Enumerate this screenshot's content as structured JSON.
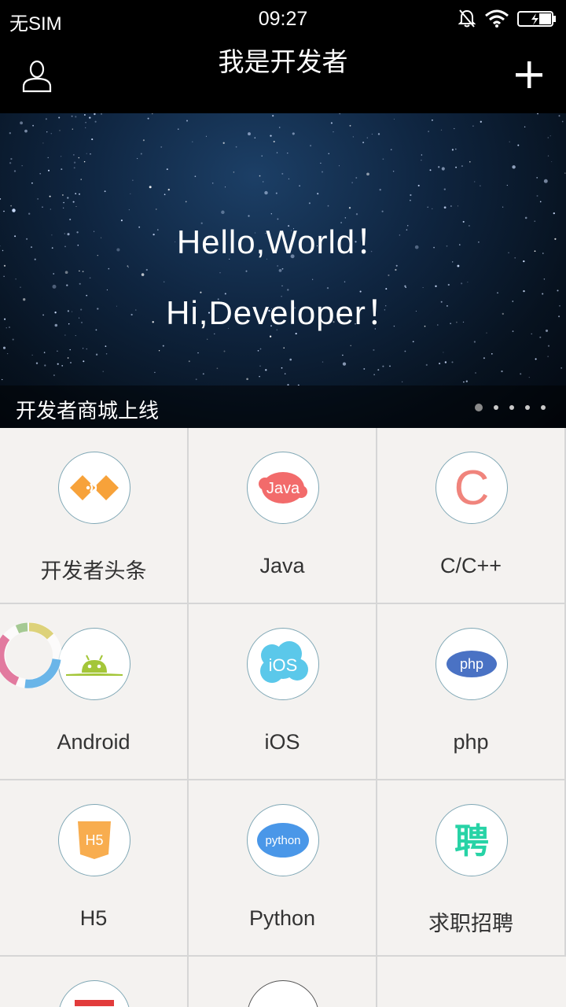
{
  "status_bar": {
    "carrier": "无SIM",
    "time": "09:27",
    "icons": [
      "mute-bell-icon",
      "wifi-icon",
      "battery-charging-icon"
    ]
  },
  "title_bar": {
    "title": "我是开发者",
    "left_icon": "user-icon",
    "right_icon": "plus-icon"
  },
  "banner": {
    "line1": "Hello,World！",
    "line2": "Hi,Developer！",
    "caption": "开发者商城上线",
    "page_count": 5,
    "active_page": 1
  },
  "categories": [
    {
      "label": "开发者头条",
      "icon": "toutiao-icon",
      "icon_text": ""
    },
    {
      "label": "Java",
      "icon": "java-icon",
      "icon_text": "Java"
    },
    {
      "label": "C/C++",
      "icon": "c-icon",
      "icon_text": "C"
    },
    {
      "label": "Android",
      "icon": "android-icon",
      "icon_text": ""
    },
    {
      "label": "iOS",
      "icon": "ios-icon",
      "icon_text": "iOS"
    },
    {
      "label": "php",
      "icon": "php-icon",
      "icon_text": "php"
    },
    {
      "label": "H5",
      "icon": "html5-icon",
      "icon_text": "H5"
    },
    {
      "label": "Python",
      "icon": "python-icon",
      "icon_text": "python"
    },
    {
      "label": "求职招聘",
      "icon": "recruit-icon",
      "icon_text": "聘"
    }
  ],
  "colors": {
    "java": "#f26b6b",
    "c": "#f0847c",
    "android": "#a4c639",
    "ios": "#5bc8ea",
    "php": "#4a72c4",
    "h5": "#f8ad4f",
    "python": "#4a97e8",
    "recruit": "#27d3a6",
    "toutiao": "#f7a23a"
  }
}
